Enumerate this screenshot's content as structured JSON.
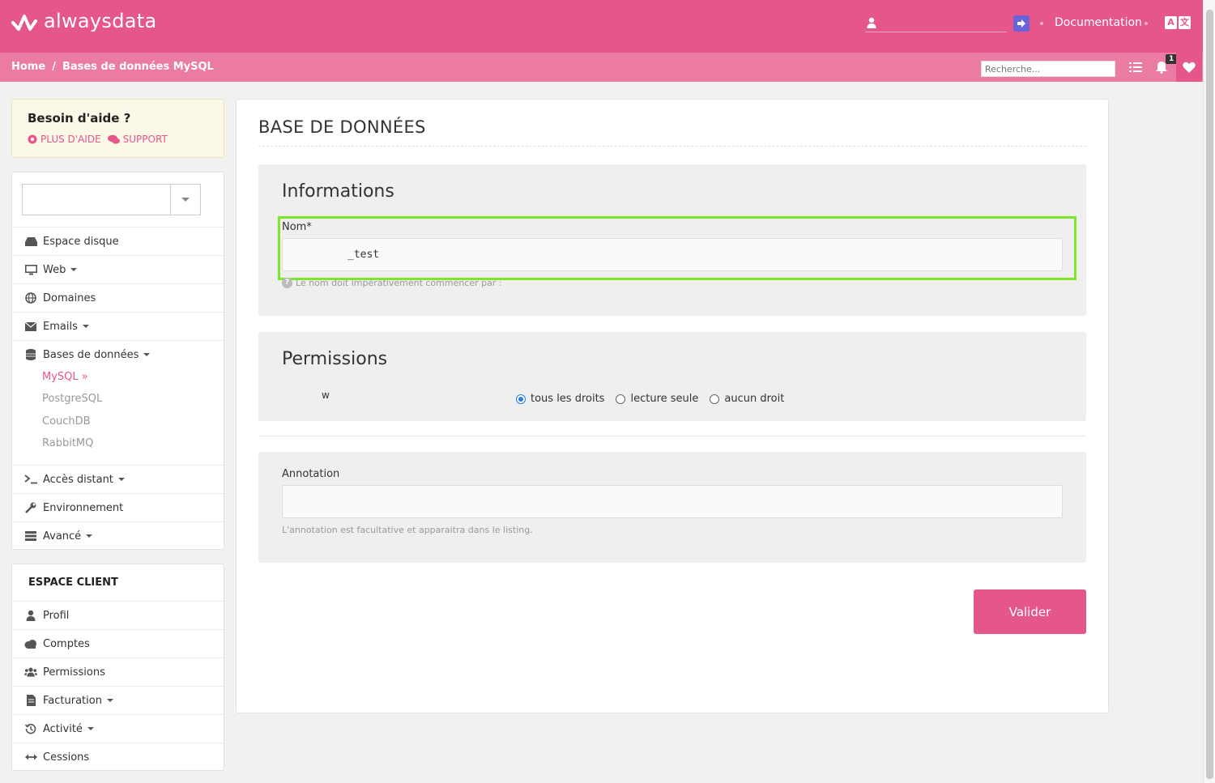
{
  "header": {
    "brand": "alwaysdata",
    "documentation": "Documentation",
    "lang_left": "A",
    "lang_right": "文"
  },
  "breadcrumb": {
    "home": "Home",
    "separator": "/",
    "current": "Bases de données MySQL"
  },
  "search": {
    "placeholder": "Recherche..."
  },
  "notifications": {
    "count": "1"
  },
  "help": {
    "title": "Besoin d'aide ?",
    "more_help": "PLUS D'AIDE",
    "support": "SUPPORT"
  },
  "sidebar": {
    "items": [
      {
        "label": "Espace disque",
        "icon": "hdd-icon"
      },
      {
        "label": "Web",
        "icon": "monitor-icon"
      },
      {
        "label": "Domaines",
        "icon": "globe-icon"
      },
      {
        "label": "Emails",
        "icon": "envelope-icon"
      },
      {
        "label": "Bases de données",
        "icon": "database-icon"
      },
      {
        "label": "Accès distant",
        "icon": "terminal-icon"
      },
      {
        "label": "Environnement",
        "icon": "wrench-icon"
      },
      {
        "label": "Avancé",
        "icon": "server-icon"
      }
    ],
    "db_sub": [
      "MySQL »",
      "PostgreSQL",
      "CouchDB",
      "RabbitMQ"
    ]
  },
  "client": {
    "title": "ESPACE CLIENT",
    "items": [
      {
        "label": "Profil",
        "icon": "user-icon"
      },
      {
        "label": "Comptes",
        "icon": "cloud-icon"
      },
      {
        "label": "Permissions",
        "icon": "users-icon"
      },
      {
        "label": "Facturation",
        "icon": "invoice-icon"
      },
      {
        "label": "Activité",
        "icon": "history-icon"
      },
      {
        "label": "Cessions",
        "icon": "arrows-icon"
      }
    ]
  },
  "main": {
    "title": "BASE DE DONNÉES",
    "informations": {
      "title": "Informations",
      "name_label": "Nom*",
      "name_value": "_test",
      "hint": "Le nom doit impérativement commencer par :"
    },
    "permissions": {
      "title": "Permissions",
      "user": "w",
      "options": [
        "tous les droits",
        "lecture seule",
        "aucun droit"
      ],
      "selected": "tous les droits"
    },
    "annotation": {
      "label": "Annotation",
      "value": "",
      "hint": "L'annotation est facultative et apparaitra dans le listing."
    },
    "submit": "Valider"
  },
  "colors": {
    "brand": "#e5568b",
    "brand_light": "#ec7ba3",
    "highlight": "#7ee629"
  }
}
